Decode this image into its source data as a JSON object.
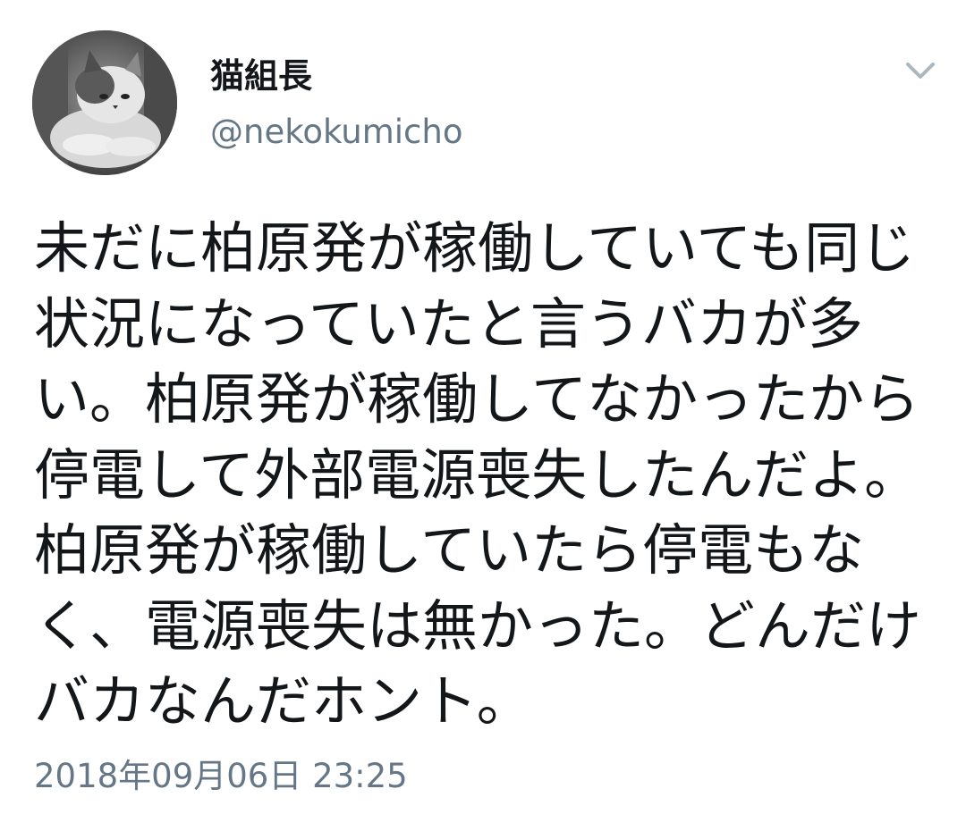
{
  "tweet": {
    "display_name": "猫組長",
    "handle": "@nekokumicho",
    "avatar_icon": "cat-photo-avatar",
    "menu_icon": "chevron-down-icon",
    "text": "未だに柏原発が稼働していても同じ状況になっていたと言うバカが多い。柏原発が稼働してなかったから停電して外部電源喪失したんだよ。柏原発が稼働していたら停電もなく、電源喪失は無かった。どんだけバカなんだホント。",
    "timestamp": "2018年09月06日 23:25"
  },
  "colors": {
    "text": "#14171a",
    "secondary": "#657786",
    "chevron": "#aab8c2",
    "background": "#ffffff"
  }
}
